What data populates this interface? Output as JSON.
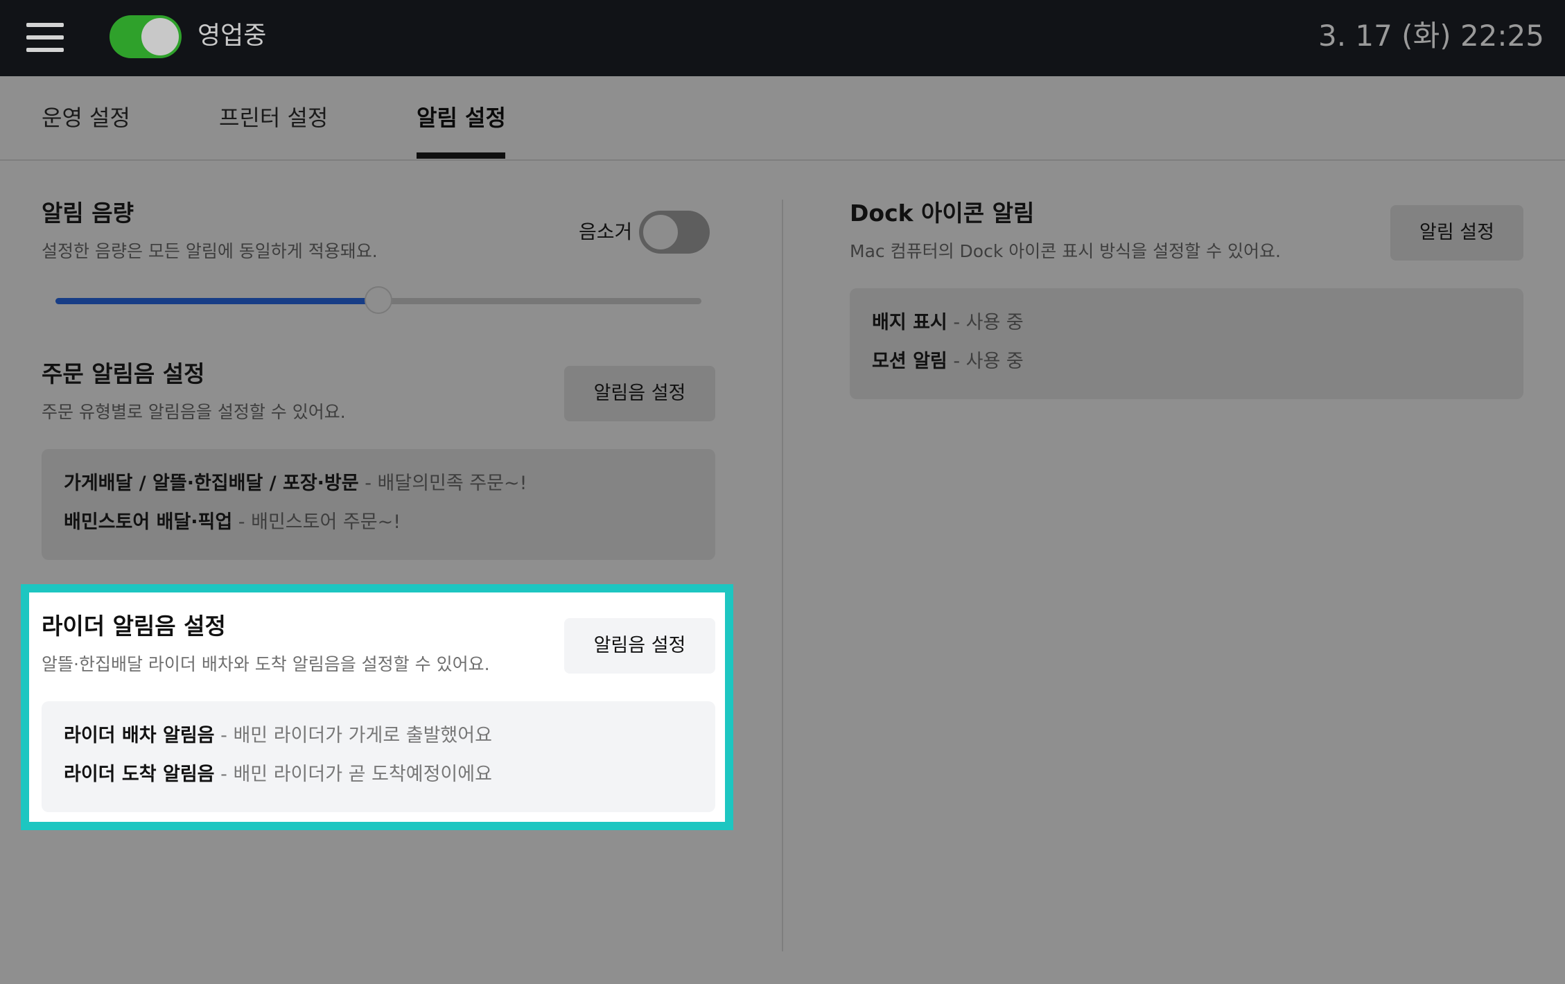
{
  "topbar": {
    "menu_icon": "hamburger-menu-icon",
    "status_label": "영업중",
    "status_on": true,
    "datetime": "3. 17 (화) 22:25"
  },
  "tabs": [
    {
      "label": "운영 설정",
      "active": false
    },
    {
      "label": "프린터 설정",
      "active": false
    },
    {
      "label": "알림 설정",
      "active": true
    }
  ],
  "volume": {
    "title": "알림 음량",
    "description": "설정한 음량은 모든 알림에 동일하게 적용돼요.",
    "mute_label": "음소거",
    "muted": false,
    "level_fraction": 0.5
  },
  "order_sound": {
    "title": "주문 알림음 설정",
    "description": "주문 유형별로 알림음을 설정할 수 있어요.",
    "button_label": "알림음 설정",
    "items": [
      {
        "name": "가게배달 / 알뜰·한집배달 / 포장·방문",
        "value": " - 배달의민족 주문~!"
      },
      {
        "name": "배민스토어 배달·픽업",
        "value": " - 배민스토어 주문~!"
      }
    ]
  },
  "rider_sound": {
    "title": "라이더 알림음 설정",
    "description": "알뜰·한집배달 라이더 배차와 도착 알림음을 설정할 수 있어요.",
    "button_label": "알림음 설정",
    "items": [
      {
        "name": "라이더 배차 알림음",
        "value": " - 배민 라이더가 가게로 출발했어요"
      },
      {
        "name": "라이더 도착 알림음",
        "value": " - 배민 라이더가 곧 도착예정이에요"
      }
    ]
  },
  "dock": {
    "title": "Dock 아이콘 알림",
    "description": "Mac 컴퓨터의 Dock 아이콘 표시 방식을 설정할 수 있어요.",
    "button_label": "알림 설정",
    "items": [
      {
        "name": "배지 표시",
        "value": " - 사용 중"
      },
      {
        "name": "모션 알림",
        "value": " - 사용 중"
      }
    ]
  },
  "colors": {
    "highlight_border": "#1dc6c1",
    "toggle_on": "#2fa12b",
    "slider_fill": "#173d86"
  }
}
